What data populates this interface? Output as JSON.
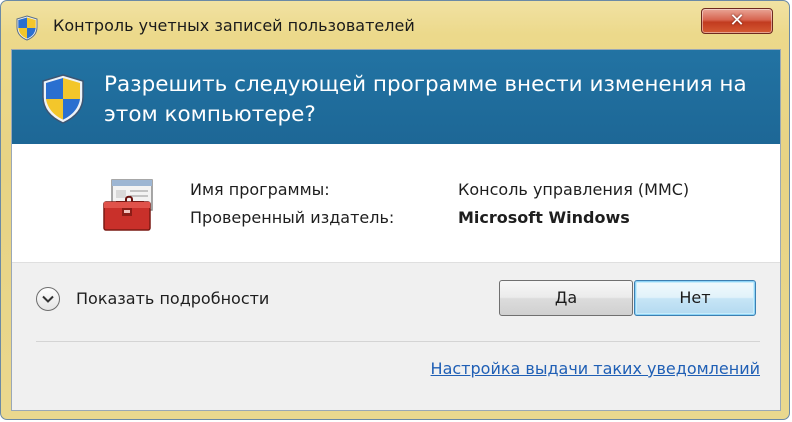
{
  "window": {
    "title": "Контроль учетных записей пользователей",
    "close_glyph": "✕",
    "title_icon": "uac-shield-icon",
    "close_icon": "close-icon"
  },
  "banner": {
    "question": "Разрешить следующей программе внести изменения на этом компьютере?",
    "icon": "uac-shield-icon",
    "background_color": "#2273a3"
  },
  "details": {
    "icon": "toolbox-icon",
    "program_label": "Имя программы:",
    "program_value": "Консоль управления (MMC)",
    "publisher_label": "Проверенный издатель:",
    "publisher_value": "Microsoft Windows"
  },
  "footer": {
    "show_details_label": "Показать подробности",
    "toggle_icon": "chevron-down-icon",
    "yes_button": "Да",
    "no_button": "Нет",
    "settings_link": "Настройка выдачи таких уведомлений",
    "link_color": "#1f5fb5"
  }
}
